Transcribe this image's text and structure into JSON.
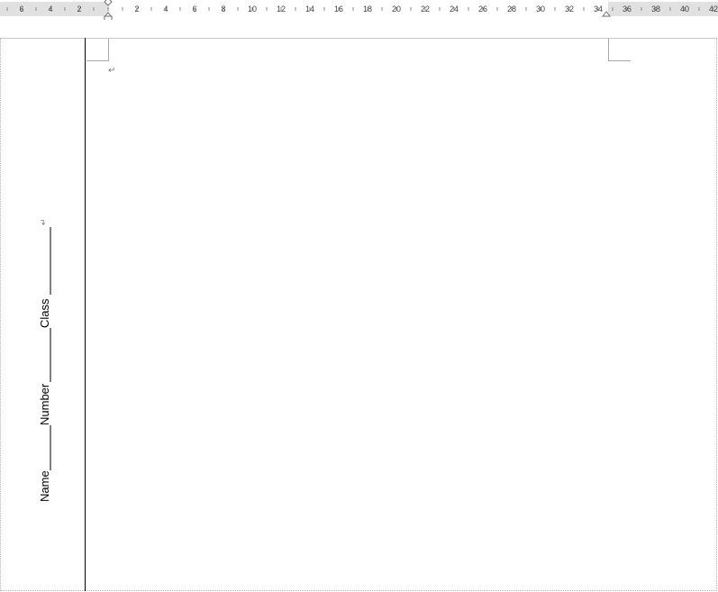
{
  "ruler": {
    "labels": [
      "6",
      "4",
      "2",
      "2",
      "4",
      "6",
      "8",
      "10",
      "12",
      "14",
      "16",
      "18",
      "20",
      "22",
      "24",
      "26",
      "28",
      "30",
      "32",
      "34",
      "36",
      "38",
      "40",
      "42"
    ]
  },
  "document": {
    "paragraph_mark": "↵",
    "binding_info": {
      "name_label": "Name",
      "number_label": "Number",
      "class_label": "Class",
      "line_break_mark": "↵"
    }
  }
}
